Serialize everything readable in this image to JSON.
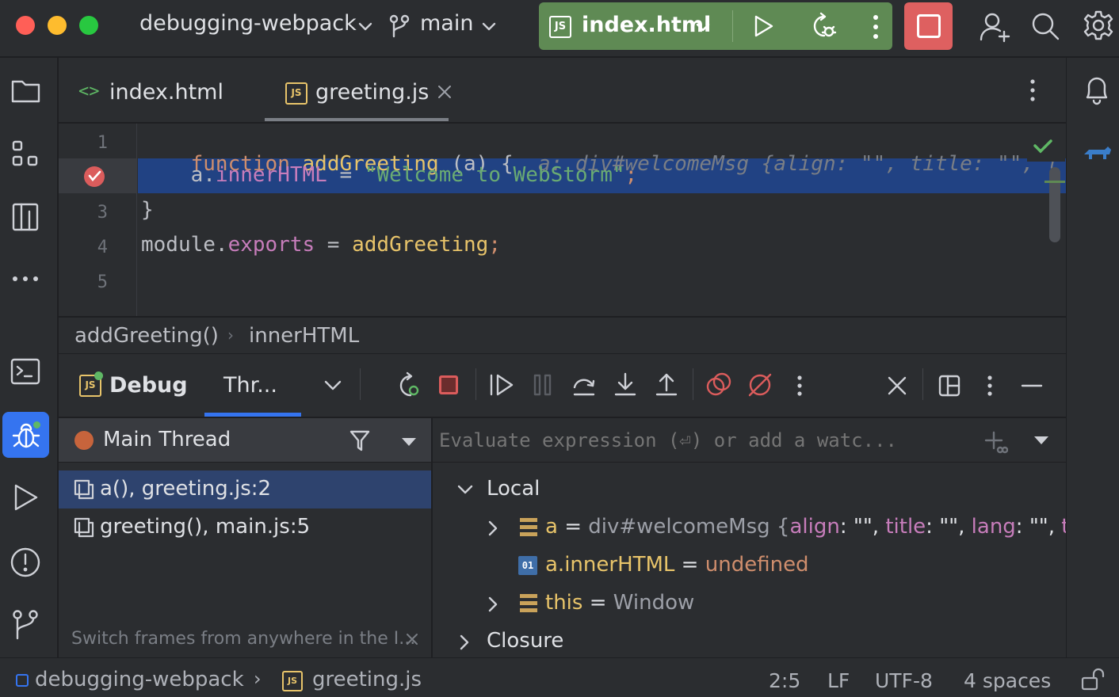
{
  "titlebar": {
    "project": "debugging-webpack",
    "branch": "main",
    "run_config": "index.html",
    "colors": {
      "run_bg": "#5f8a54",
      "stop_bg": "#de6060",
      "close": "#ff5f57",
      "minimize": "#febc2e",
      "zoom": "#28c840"
    },
    "icons": [
      "branch-icon",
      "run-icon",
      "rerun-debug-icon",
      "more-icon",
      "stop-icon",
      "add-user-icon",
      "search-icon",
      "settings-icon"
    ]
  },
  "sidebar": {
    "icons": [
      "project-icon",
      "structure-icon",
      "bookmarks-icon",
      "more-icon",
      "terminal-icon",
      "debug-icon",
      "run-icon",
      "problems-icon",
      "git-icon"
    ]
  },
  "tabs": [
    {
      "label": "index.html",
      "icon": "html-file-icon",
      "active": false
    },
    {
      "label": "greeting.js",
      "icon": "js-file-icon",
      "active": true
    }
  ],
  "editor": {
    "line_numbers": [
      "1",
      "3",
      "4",
      "5"
    ],
    "line1": {
      "kw": "function",
      "name": "addGreeting",
      "rest": " (a) {",
      "hint": "a: div#welcomeMsg {align: \"\", title: \"\", l"
    },
    "line2": {
      "obj": "a",
      "dot": ".",
      "prop": "innerHTML",
      "eq": " = ",
      "str": "\"Welcome to WebStorm\"",
      "semi": ";"
    },
    "line3": "}",
    "line4": {
      "obj": "module",
      "dot": ".",
      "prop": "exports",
      "eq": " = ",
      "fn": "addGreeting",
      "semi": ";"
    }
  },
  "breadcrumbs": [
    "addGreeting()",
    "innerHTML"
  ],
  "debug": {
    "tab_debug": "Debug",
    "tab_threads": "Thr...",
    "thread": "Main Thread",
    "frames": [
      {
        "label": "a(), greeting.js:2",
        "selected": true
      },
      {
        "label": "greeting(), main.js:5",
        "selected": false
      }
    ],
    "hint": "Switch frames from anywhere in the I...",
    "evaluate_placeholder": "Evaluate expression (⏎) or add a watc...",
    "local_label": "Local",
    "closure_label": "Closure",
    "variables": [
      {
        "name": "a",
        "eq": " = ",
        "value": "div#welcomeMsg {",
        "k1": "align",
        "v1": ": \"\", ",
        "k2": "title",
        "v2": ": \"\", ",
        "k3": "lang",
        "v3": ": \"\", ",
        "k4": "trar"
      },
      {
        "name": "a.innerHTML",
        "eq": " = ",
        "value": "undefined"
      },
      {
        "name": "this",
        "eq": " = ",
        "value": "Window"
      }
    ]
  },
  "status": {
    "project": "debugging-webpack",
    "file": "greeting.js",
    "position": "2:5",
    "line_sep": "LF",
    "encoding": "UTF-8",
    "indent": "4 spaces"
  }
}
